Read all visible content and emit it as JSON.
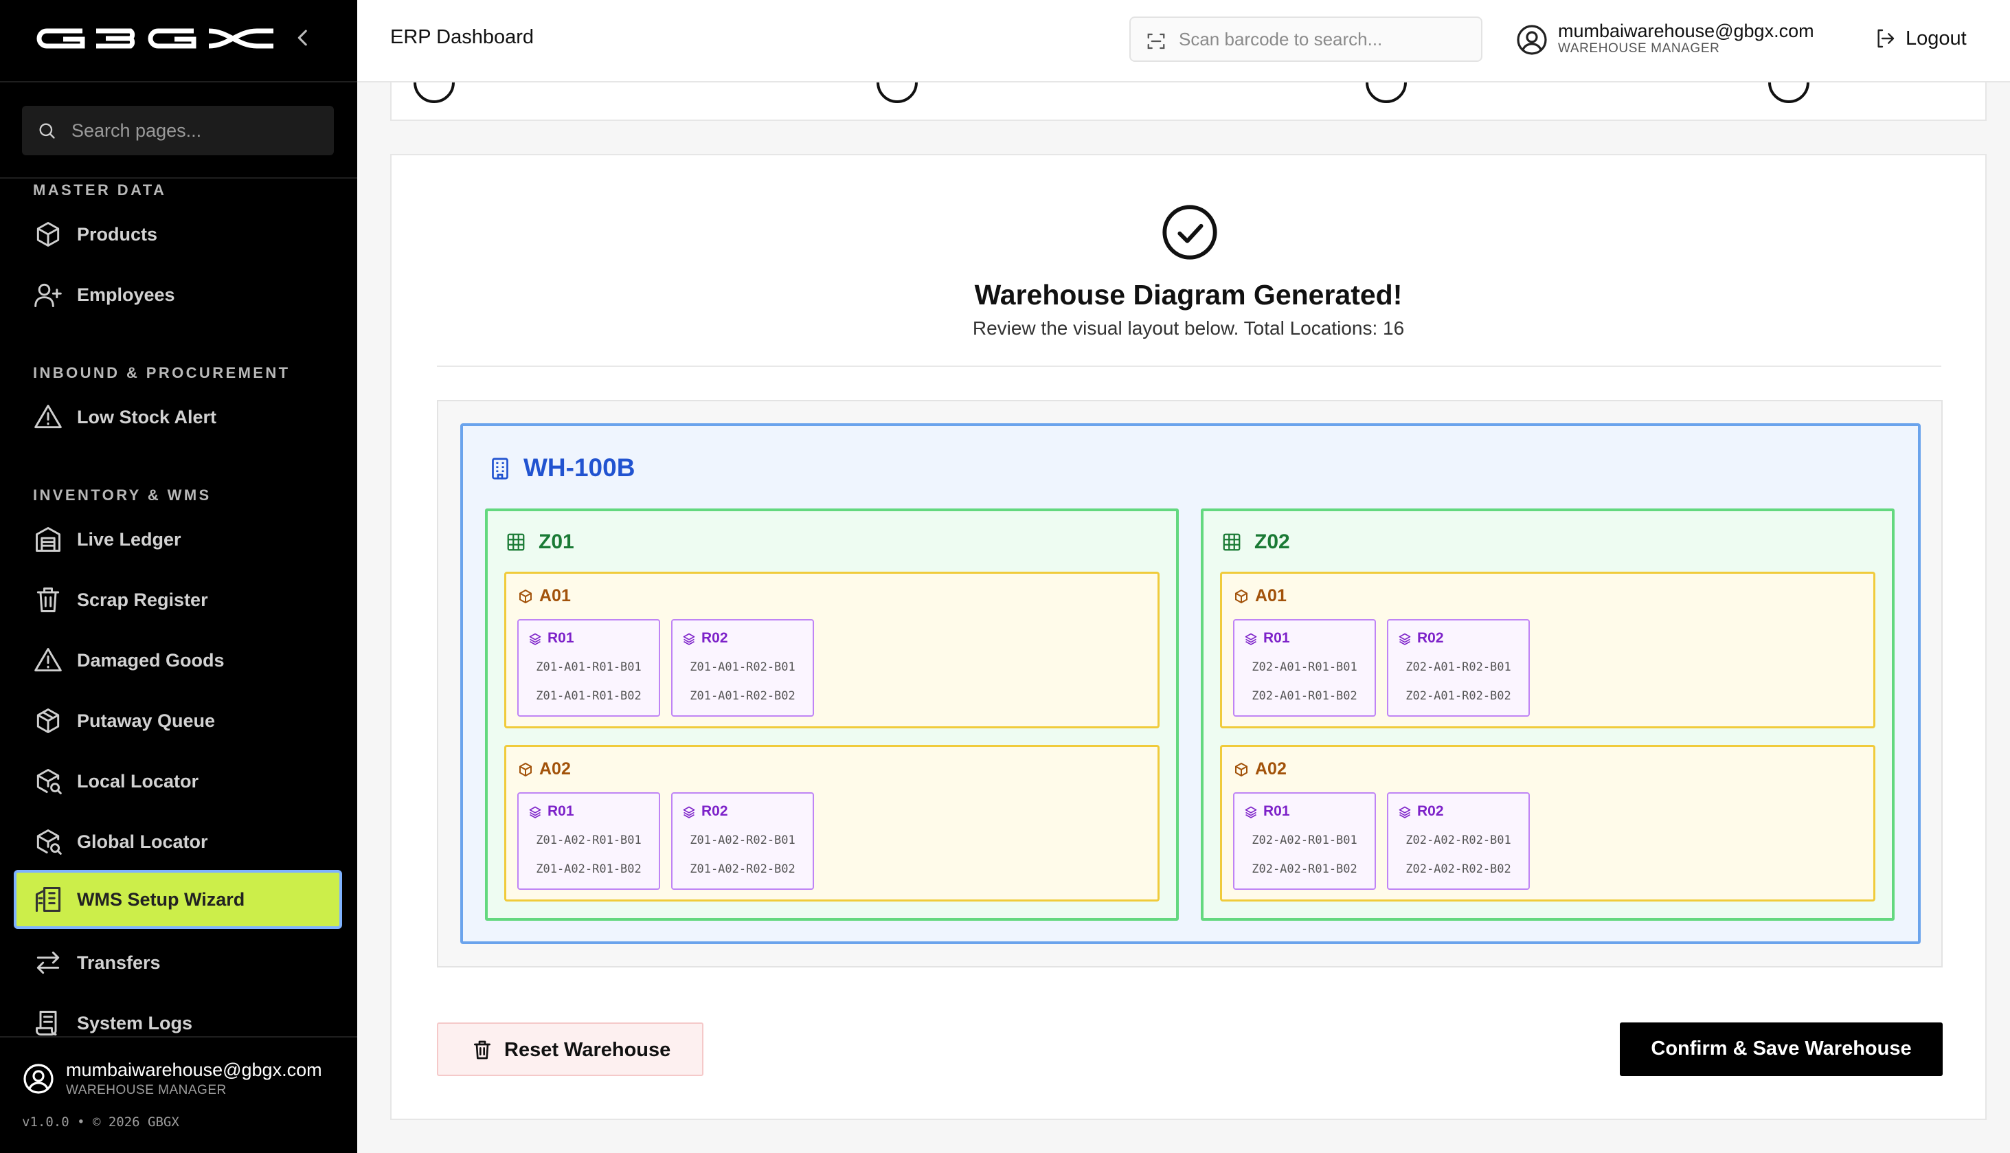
{
  "sidebar": {
    "logo_text": "GBGX",
    "search_placeholder": "Search pages...",
    "sections": [
      {
        "title": "MASTER DATA",
        "items": [
          {
            "label": "Products",
            "icon": "box-icon"
          },
          {
            "label": "Employees",
            "icon": "user-plus-icon"
          }
        ]
      },
      {
        "title": "INBOUND & PROCUREMENT",
        "items": [
          {
            "label": "Low Stock Alert",
            "icon": "alert-triangle-icon"
          }
        ]
      },
      {
        "title": "INVENTORY & WMS",
        "items": [
          {
            "label": "Live Ledger",
            "icon": "warehouse-icon"
          },
          {
            "label": "Scrap Register",
            "icon": "trash-icon"
          },
          {
            "label": "Damaged Goods",
            "icon": "alert-triangle-icon"
          },
          {
            "label": "Putaway Queue",
            "icon": "package-icon"
          },
          {
            "label": "Local Locator",
            "icon": "package-search-icon"
          },
          {
            "label": "Global Locator",
            "icon": "package-search-icon"
          },
          {
            "label": "WMS Setup Wizard",
            "icon": "building-icon",
            "active": true
          },
          {
            "label": "Transfers",
            "icon": "arrows-left-right-icon"
          },
          {
            "label": "System Logs",
            "icon": "scroll-icon"
          }
        ]
      }
    ],
    "footer": {
      "email": "mumbaiwarehouse@gbgx.com",
      "role": "WAREHOUSE MANAGER",
      "version": "v1.0.0 • © 2026 GBGX"
    }
  },
  "header": {
    "title": "ERP Dashboard",
    "barcode_placeholder": "Scan barcode to search...",
    "user_email": "mumbaiwarehouse@gbgx.com",
    "user_role": "WAREHOUSE MANAGER",
    "logout_label": "Logout"
  },
  "result": {
    "title": "Warehouse Diagram Generated!",
    "subtitle": "Review the visual layout below. Total Locations: 16",
    "total_locations": 16
  },
  "warehouse": {
    "code": "WH-100B",
    "zones": [
      {
        "code": "Z01",
        "aisles": [
          {
            "code": "A01",
            "racks": [
              {
                "code": "R01",
                "bins": [
                  "Z01-A01-R01-B01",
                  "Z01-A01-R01-B02"
                ]
              },
              {
                "code": "R02",
                "bins": [
                  "Z01-A01-R02-B01",
                  "Z01-A01-R02-B02"
                ]
              }
            ]
          },
          {
            "code": "A02",
            "racks": [
              {
                "code": "R01",
                "bins": [
                  "Z01-A02-R01-B01",
                  "Z01-A02-R01-B02"
                ]
              },
              {
                "code": "R02",
                "bins": [
                  "Z01-A02-R02-B01",
                  "Z01-A02-R02-B02"
                ]
              }
            ]
          }
        ]
      },
      {
        "code": "Z02",
        "aisles": [
          {
            "code": "A01",
            "racks": [
              {
                "code": "R01",
                "bins": [
                  "Z02-A01-R01-B01",
                  "Z02-A01-R01-B02"
                ]
              },
              {
                "code": "R02",
                "bins": [
                  "Z02-A01-R02-B01",
                  "Z02-A01-R02-B02"
                ]
              }
            ]
          },
          {
            "code": "A02",
            "racks": [
              {
                "code": "R01",
                "bins": [
                  "Z02-A02-R01-B01",
                  "Z02-A02-R01-B02"
                ]
              },
              {
                "code": "R02",
                "bins": [
                  "Z02-A02-R02-B01",
                  "Z02-A02-R02-B02"
                ]
              }
            ]
          }
        ]
      }
    ]
  },
  "actions": {
    "reset_label": "Reset Warehouse",
    "confirm_label": "Confirm & Save Warehouse"
  },
  "colors": {
    "accent_active": "#ccee4a",
    "warehouse_blue": "#2153d0",
    "zone_green": "#1a7a35",
    "aisle_orange": "#a2520a",
    "rack_purple": "#7d22c9"
  }
}
